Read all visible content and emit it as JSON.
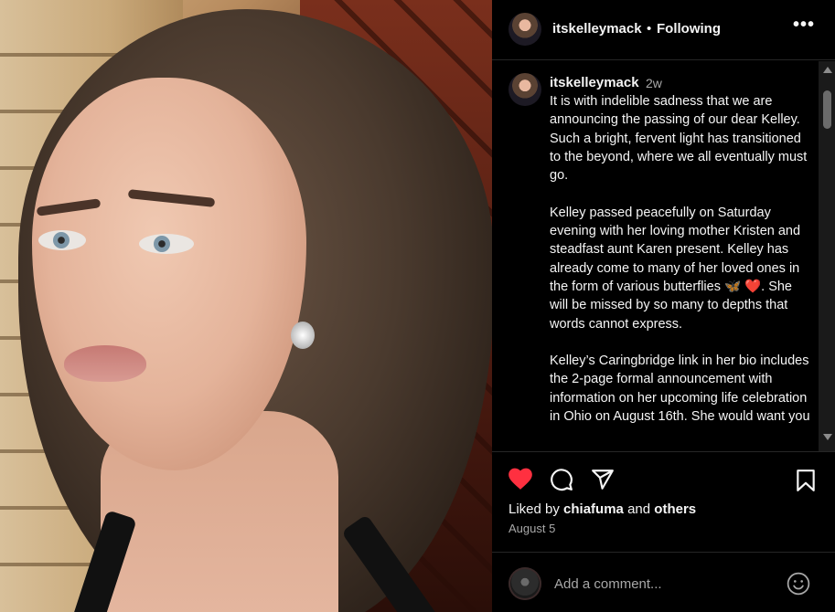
{
  "post": {
    "username": "itskelleymack",
    "separator": "•",
    "follow_status": "Following",
    "more_label": "•••",
    "time_ago": "2w",
    "caption": [
      "It is with indelible sadness that we are announcing the passing of our dear Kelley. Such a bright, fervent light has transitioned to the beyond, where we all eventually must go.",
      "Kelley passed peacefully on Saturday evening with her loving mother Kristen and steadfast aunt Karen present. Kelley has already come to many of her loved ones in the form of various butterflies 🦋 ❤️. She will be missed by so many to depths that words cannot express.",
      "Kelley’s Caringbridge link in her bio includes the 2-page formal announcement with information on her upcoming life celebration in Ohio on August 16th. She would want you"
    ],
    "liked_by_prefix": "Liked by ",
    "liked_by_user": "chiafuma",
    "liked_by_join": " and ",
    "liked_by_others": "others",
    "date": "August 5"
  },
  "comment_box": {
    "placeholder": "Add a comment..."
  },
  "icons": {
    "like": "heart-filled-icon",
    "comment": "comment-icon",
    "share": "send-icon",
    "save": "bookmark-icon",
    "emoji": "emoji-icon",
    "more": "more-icon"
  },
  "colors": {
    "like_red": "#ff3040",
    "panel_bg": "#000000",
    "muted_text": "#a8a8a8",
    "divider": "#262626"
  }
}
